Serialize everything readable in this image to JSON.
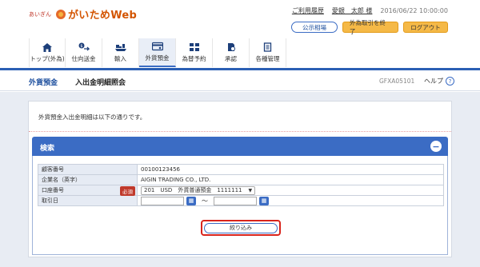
{
  "header": {
    "logo_small": "あいぎん",
    "logo_main": "がいためWeb",
    "usage_history_link": "ご利用履歴",
    "user_name": "愛銀　太郎 様",
    "datetime": "2016/06/22 10:00:00",
    "buttons": {
      "public_rates": "公示相場",
      "end_fx": "外為取引を終了",
      "logout": "ログアウト"
    }
  },
  "nav": {
    "items": [
      {
        "label": "トップ(外為)",
        "icon": "home-icon"
      },
      {
        "label": "仕向送金",
        "icon": "remittance-icon"
      },
      {
        "label": "輸入",
        "icon": "import-icon"
      },
      {
        "label": "外貨預金",
        "icon": "foreign-deposit-icon",
        "active": true
      },
      {
        "label": "為替予約",
        "icon": "exchange-reservation-icon"
      },
      {
        "label": "承認",
        "icon": "approval-icon"
      },
      {
        "label": "各種管理",
        "icon": "management-icon"
      }
    ],
    "accent_color": "#3b6cc4"
  },
  "page": {
    "category": "外貨預金",
    "title": "入出金明細照会",
    "screen_code": "GFXA05101",
    "help_label": "ヘルプ",
    "help_icon": "?"
  },
  "main": {
    "intro_text": "外貨預金入出金明細は以下の通りです。",
    "search_panel": {
      "title": "検索",
      "collapse_icon": "−",
      "rows": {
        "customer_number_label": "顧客番号",
        "customer_number_value": "00100123456",
        "company_name_label": "企業名（英字）",
        "company_name_value": "AIGIN TRADING CO., LTD.",
        "account_label": "口座番号",
        "required_badge": "必須",
        "account_value": "201　USD　外貨普通預金　1111111",
        "trade_date_label": "取引日",
        "date_separator": "～"
      },
      "filter_button": "絞り込み"
    }
  }
}
